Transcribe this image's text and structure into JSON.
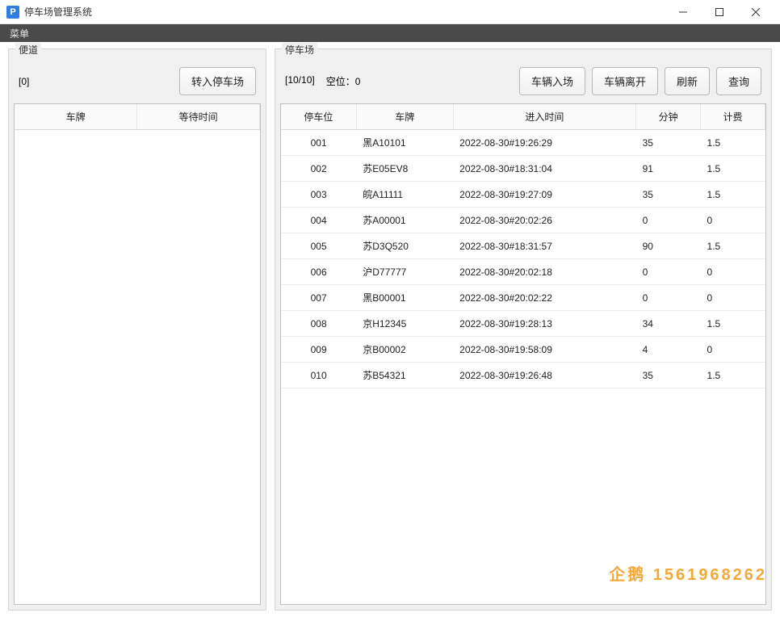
{
  "window": {
    "icon_text": "P",
    "title": "停车场管理系统"
  },
  "menubar": {
    "menu_label": "菜单"
  },
  "lane_panel": {
    "legend": "便道",
    "count": "[0]",
    "transfer_button": "转入停车场",
    "columns": {
      "plate": "车牌",
      "wait": "等待时间"
    },
    "rows": []
  },
  "lot_panel": {
    "legend": "停车场",
    "count": "[10/10]",
    "vacancy_label": "空位：0",
    "buttons": {
      "enter": "车辆入场",
      "leave": "车辆离开",
      "refresh": "刷新",
      "query": "查询"
    },
    "columns": {
      "spot": "停车位",
      "plate": "车牌",
      "enter_time": "进入时间",
      "minutes": "分钟",
      "fee": "计费"
    },
    "rows": [
      {
        "spot": "001",
        "plate": "黑A10101",
        "enter_time": "2022-08-30#19:26:29",
        "minutes": "35",
        "fee": "1.5"
      },
      {
        "spot": "002",
        "plate": "苏E05EV8",
        "enter_time": "2022-08-30#18:31:04",
        "minutes": "91",
        "fee": "1.5"
      },
      {
        "spot": "003",
        "plate": "皖A11111",
        "enter_time": "2022-08-30#19:27:09",
        "minutes": "35",
        "fee": "1.5"
      },
      {
        "spot": "004",
        "plate": "苏A00001",
        "enter_time": "2022-08-30#20:02:26",
        "minutes": "0",
        "fee": "0"
      },
      {
        "spot": "005",
        "plate": "苏D3Q520",
        "enter_time": "2022-08-30#18:31:57",
        "minutes": "90",
        "fee": "1.5"
      },
      {
        "spot": "006",
        "plate": "沪D77777",
        "enter_time": "2022-08-30#20:02:18",
        "minutes": "0",
        "fee": "0"
      },
      {
        "spot": "007",
        "plate": "黑B00001",
        "enter_time": "2022-08-30#20:02:22",
        "minutes": "0",
        "fee": "0"
      },
      {
        "spot": "008",
        "plate": "京H12345",
        "enter_time": "2022-08-30#19:28:13",
        "minutes": "34",
        "fee": "1.5"
      },
      {
        "spot": "009",
        "plate": "京B00002",
        "enter_time": "2022-08-30#19:58:09",
        "minutes": "4",
        "fee": "0"
      },
      {
        "spot": "010",
        "plate": "苏B54321",
        "enter_time": "2022-08-30#19:26:48",
        "minutes": "35",
        "fee": "1.5"
      }
    ]
  },
  "watermark": "企鹅 1561968262"
}
